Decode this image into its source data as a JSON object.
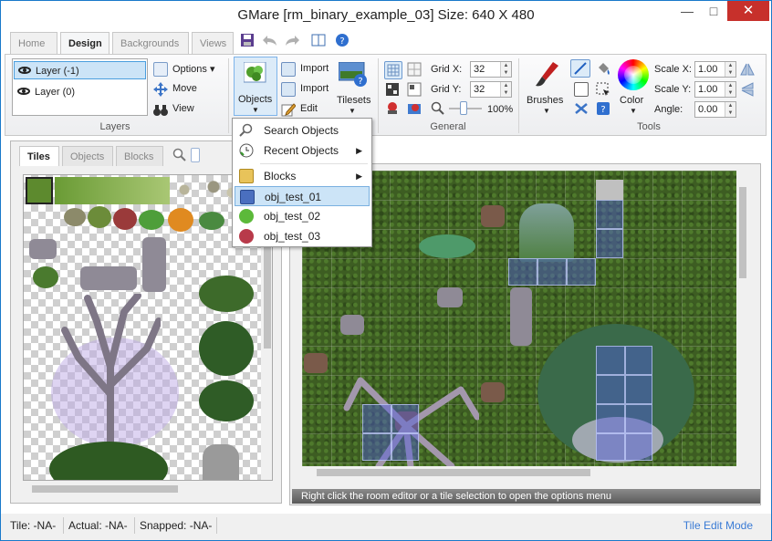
{
  "window": {
    "title": "GMare [rm_binary_example_03] Size: 640 X 480"
  },
  "ribbon_tabs": [
    {
      "label": "Home"
    },
    {
      "label": "Design"
    },
    {
      "label": "Backgrounds"
    },
    {
      "label": "Views"
    }
  ],
  "layers_group": {
    "label": "Layers",
    "items": [
      {
        "label": "Layer (-1)"
      },
      {
        "label": "Layer (0)"
      }
    ],
    "options_label": "Options",
    "move_label": "Move",
    "view_label": "View"
  },
  "resources_group": {
    "objects_label": "Objects",
    "import_label": "Import",
    "import2_label": "Import",
    "edit_label": "Edit",
    "tilesets_label": "Tilesets"
  },
  "general_group": {
    "label": "General",
    "grid_x_label": "Grid X:",
    "grid_x_value": "32",
    "grid_y_label": "Grid Y:",
    "grid_y_value": "32",
    "zoom_value": "100%"
  },
  "tools_group": {
    "label": "Tools",
    "brushes_label": "Brushes",
    "color_label": "Color",
    "scale_x_label": "Scale X:",
    "scale_x_value": "1.00",
    "scale_y_label": "Scale Y:",
    "scale_y_value": "1.00",
    "angle_label": "Angle:",
    "angle_value": "0.00"
  },
  "objects_menu": {
    "items": [
      {
        "label": "Search Objects"
      },
      {
        "label": "Recent Objects"
      },
      {
        "label": "Blocks"
      },
      {
        "label": "obj_test_01"
      },
      {
        "label": "obj_test_02"
      },
      {
        "label": "obj_test_03"
      }
    ]
  },
  "left_panel": {
    "tabs": [
      {
        "label": "Tiles"
      },
      {
        "label": "Objects"
      },
      {
        "label": "Blocks"
      }
    ]
  },
  "room_editor": {
    "hint": "Right click the room editor or a tile selection to open the options menu"
  },
  "status": {
    "tile": "Tile: -NA-",
    "actual": "Actual: -NA-",
    "snapped": "Snapped: -NA-",
    "mode": "Tile Edit Mode"
  },
  "icons": [
    "eye-icon",
    "save-icon",
    "undo-icon",
    "redo-icon",
    "book-icon",
    "help-icon",
    "options-icon",
    "move-icon",
    "binoculars-icon",
    "objects-icon",
    "import-icon",
    "edit-icon",
    "tilesets-icon",
    "grid-icon",
    "zoom-icon",
    "brush-icon",
    "pencil-icon",
    "fill-icon",
    "color-wheel-icon",
    "flip-icon",
    "search-icon",
    "clock-icon",
    "folder-icon"
  ],
  "colors": {
    "accent": "#3a7bd5",
    "selection": "#cce4f7",
    "close": "#c7302b"
  }
}
